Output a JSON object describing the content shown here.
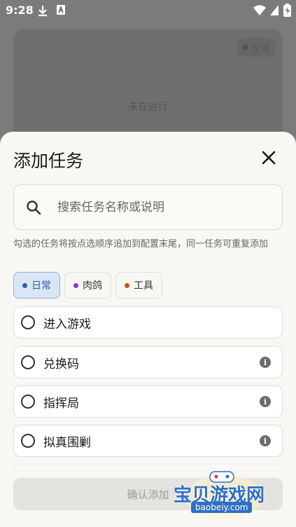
{
  "status_bar": {
    "time": "9:28"
  },
  "background": {
    "idle_label": "空闲",
    "not_running": "未在运行"
  },
  "sheet": {
    "title": "添加任务",
    "search": {
      "placeholder": "搜索任务名称或说明"
    },
    "hint": "勾选的任务将按点选顺序追加到配置末尾，同一任务可重复添加",
    "chips": [
      {
        "label": "日常",
        "color": "#2c5ea8",
        "active": true
      },
      {
        "label": "肉鸽",
        "color": "#7a3fc9",
        "active": false
      },
      {
        "label": "工具",
        "color": "#c0531f",
        "active": false
      }
    ],
    "tasks": [
      {
        "label": "进入游戏",
        "info": false
      },
      {
        "label": "兑换码",
        "info": true
      },
      {
        "label": "指挥局",
        "info": true
      },
      {
        "label": "拟真围剿",
        "info": true
      }
    ],
    "confirm_label": "确认添加"
  },
  "watermark": {
    "text": "宝贝游戏网",
    "url": "baobeiy.com"
  }
}
